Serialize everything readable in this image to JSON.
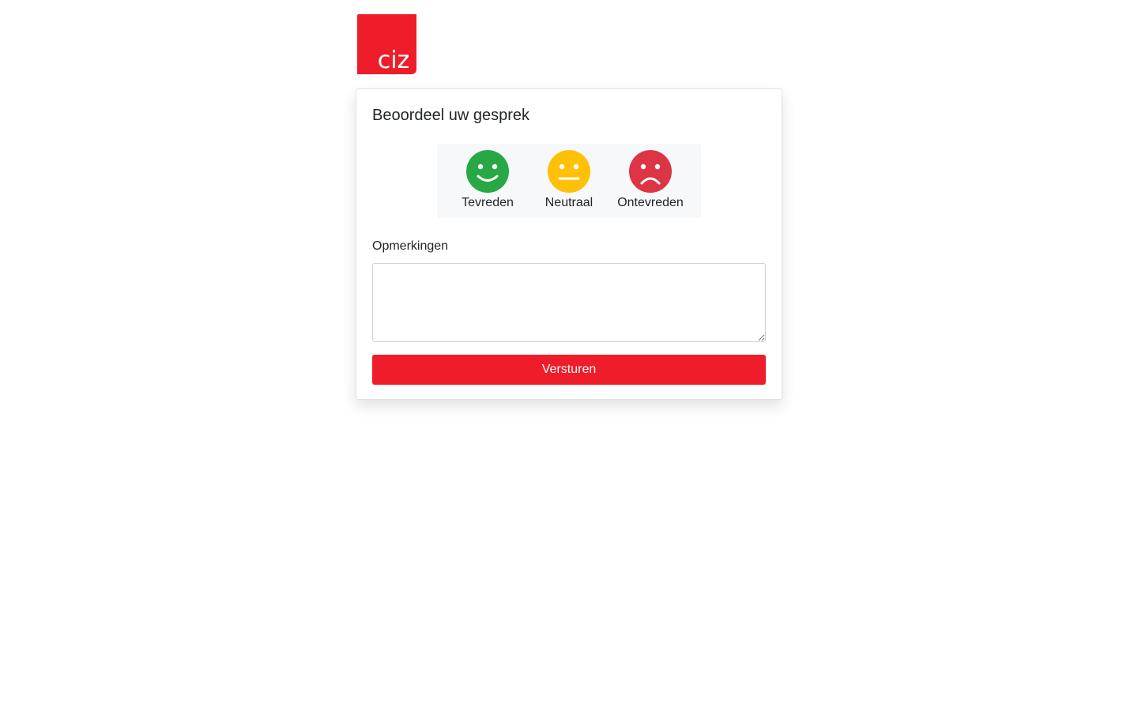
{
  "brand": {
    "logo_text": "ciz",
    "color": "#ef1c2a"
  },
  "card": {
    "title": "Beoordeel uw gesprek"
  },
  "rating": {
    "options": [
      {
        "label": "Tevreden",
        "icon": "smiley-happy-icon",
        "color": "#28a745"
      },
      {
        "label": "Neutraal",
        "icon": "smiley-neutral-icon",
        "color": "#ffc107"
      },
      {
        "label": "Ontevreden",
        "icon": "smiley-sad-icon",
        "color": "#dc3545"
      }
    ]
  },
  "comments": {
    "label": "Opmerkingen",
    "value": "",
    "placeholder": ""
  },
  "submit": {
    "label": "Versturen"
  }
}
